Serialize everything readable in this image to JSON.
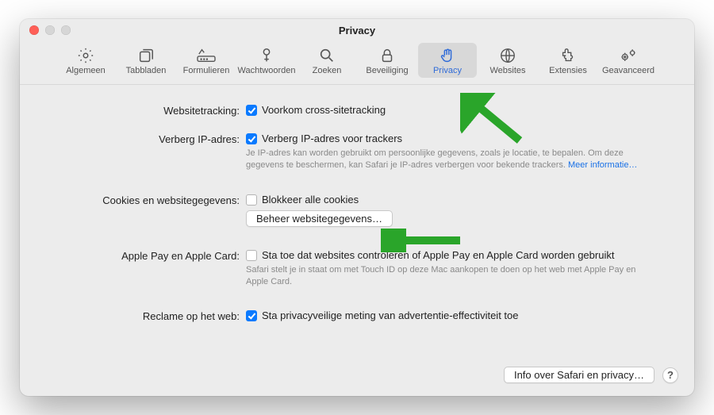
{
  "window": {
    "title": "Privacy"
  },
  "tabs": [
    {
      "label": "Algemeen"
    },
    {
      "label": "Tabbladen"
    },
    {
      "label": "Formulieren"
    },
    {
      "label": "Wachtwoorden"
    },
    {
      "label": "Zoeken"
    },
    {
      "label": "Beveiliging"
    },
    {
      "label": "Privacy"
    },
    {
      "label": "Websites"
    },
    {
      "label": "Extensies"
    },
    {
      "label": "Geavanceerd"
    }
  ],
  "section": {
    "tracking": {
      "label": "Websitetracking:",
      "option": "Voorkom cross-sitetracking"
    },
    "ip": {
      "label": "Verberg IP-adres:",
      "option": "Verberg IP-adres voor trackers",
      "help": "Je IP-adres kan worden gebruikt om persoonlijke gegevens, zoals je locatie, te bepalen. Om deze gegevens te beschermen, kan Safari je IP-adres verbergen voor bekende trackers. ",
      "more": "Meer informatie…"
    },
    "cookies": {
      "label": "Cookies en websitegegevens:",
      "option": "Blokkeer alle cookies",
      "button": "Beheer websitegegevens…"
    },
    "applepay": {
      "label": "Apple Pay en Apple Card:",
      "option": "Sta toe dat websites controleren of Apple Pay en Apple Card worden gebruikt",
      "help": "Safari stelt je in staat om met Touch ID op deze Mac aankopen te doen op het web met Apple Pay en Apple Card."
    },
    "ads": {
      "label": "Reclame op het web:",
      "option": "Sta privacyveilige meting van advertentie-effectiviteit toe"
    }
  },
  "footer": {
    "about": "Info over Safari en privacy…",
    "help": "?"
  }
}
